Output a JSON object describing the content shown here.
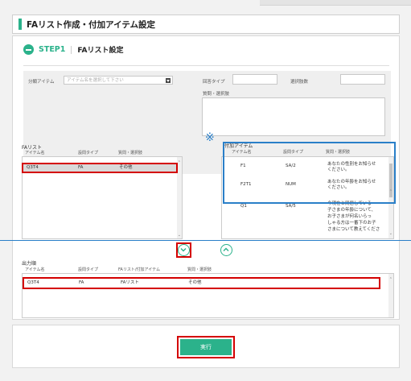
{
  "page": {
    "title": "FAリスト作成・付加アイテム設定"
  },
  "step": {
    "number": "STEP1",
    "label": "FAリスト設定"
  },
  "form": {
    "category_label": "分類アイテム",
    "category_placeholder": "アイテム名を選択して下さい",
    "answer_type_label": "回答タイプ",
    "choice_count_label": "選択肢数",
    "question_label": "質問・選択肢"
  },
  "fa_list": {
    "label": "FAリスト",
    "headers": [
      "アイテム名",
      "設問タイプ",
      "質問・選択肢"
    ],
    "rows": [
      {
        "name": "Q3T4",
        "type": "FA",
        "text": "その他"
      }
    ]
  },
  "marker": "※",
  "additional": {
    "label": "付加アイテム",
    "headers": [
      "アイテム名",
      "設問タイプ",
      "質問・選択肢"
    ],
    "rows": [
      {
        "name": "F1",
        "type": "SA/2",
        "text1": "あなたの性別をお知らせ",
        "text2": "ください。"
      },
      {
        "name": "F2T1",
        "type": "NUM",
        "text1": "あなたの年齢をお知らせ",
        "text2": "ください。"
      },
      {
        "name": "Q1",
        "type": "SA/5",
        "text1": "今現在と同居している",
        "text2": "子さまの年齢について、",
        "text3": "お子さまが何名いらっ",
        "text4": "しゃる方は一番下のお子",
        "text5": "さまについて教えてくださ"
      }
    ]
  },
  "output": {
    "label": "出力順",
    "headers": [
      "アイテム名",
      "設問タイプ",
      "FAリスト/付加アイテム",
      "質問・選択肢"
    ],
    "rows": [
      {
        "name": "Q3T4",
        "type": "FA",
        "source": "FAリスト",
        "text": "その他"
      }
    ]
  },
  "footer": {
    "run_label": "実行"
  },
  "colors": {
    "accent": "#2bb28b",
    "highlight_red": "#d40000",
    "annotation_blue": "#2a7fc8"
  }
}
